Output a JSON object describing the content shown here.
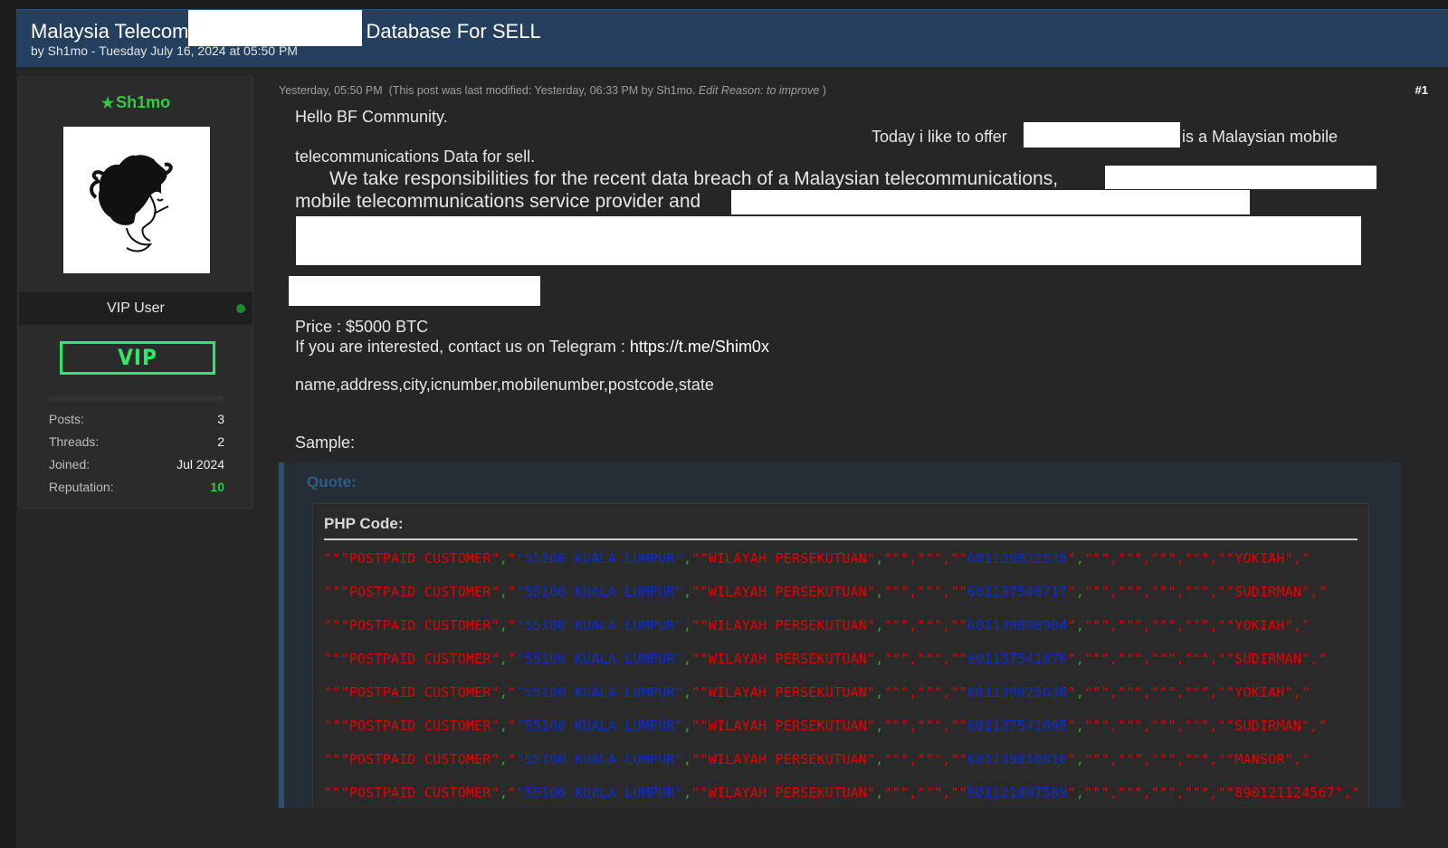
{
  "thread": {
    "title_prefix": "Malaysia Telecom",
    "title_suffix": "Database For SELL",
    "byline": "by Sh1mo - Tuesday July 16, 2024 at 05:50 PM"
  },
  "user": {
    "name": "Sh1mo",
    "role": "VIP User",
    "badge": "VIP",
    "stats": [
      {
        "label": "Posts:",
        "value": "3"
      },
      {
        "label": "Threads:",
        "value": "2"
      },
      {
        "label": "Joined:",
        "value": "Jul 2024"
      },
      {
        "label": "Reputation:",
        "value": "10"
      }
    ]
  },
  "post": {
    "meta_time": "Yesterday, 05:50 PM",
    "meta_modified": "(This post was last modified: Yesterday, 06:33 PM by Sh1mo.",
    "meta_reason": "Edit Reason: to improve",
    "meta_close": ")",
    "number": "#1",
    "greeting": "Hello BF Community.",
    "offer_pre": "Today i like to offer",
    "offer_post": "is a Malaysian mobile",
    "offer_cont": "telecommunications Data for sell.",
    "resp_line1": "We take responsibilities for the recent data breach of a Malaysian telecommunications,",
    "resp_line2": "mobile telecommunications service provider and",
    "price": "Price : $5000 BTC",
    "contact_pre": "If you are interested, contact us on Telegram :",
    "contact_link": "https://t.me/Shim0x",
    "fields": "name,address,city,icnumber,mobilenumber,postcode,state",
    "sample_label": "Sample:"
  },
  "quote": {
    "label": "Quote:",
    "code_label": "PHP Code:",
    "prefix": "\"\"\"POSTPAID CUSTOMER\"",
    "city": "\"55100 KUALA LUMPUR\"",
    "state": "\"\"WILAYAH PERSEKUTUAN\"",
    "empties": "\"\"\",\"\"\",\"\"",
    "tail_empties": "\"\"\",\"\"\",\"\"\",\"\"\",\"\"",
    "lines": [
      {
        "number": "601139022528",
        "name": "YOKIAH"
      },
      {
        "number": "601137540717",
        "name": "SUDIRMAN"
      },
      {
        "number": "601139008904",
        "name": "YOKIAH"
      },
      {
        "number": "601137541076",
        "name": "SUDIRMAN"
      },
      {
        "number": "601139025630",
        "name": "YOKIAH"
      },
      {
        "number": "601137541095",
        "name": "SUDIRMAN"
      },
      {
        "number": "601139010816",
        "name": "MANSOR"
      },
      {
        "number": "601121807589",
        "name": "890121124567"
      }
    ]
  },
  "colors": {
    "header_bg": "#24405e",
    "username": "#2ecc40",
    "vip_badge": "#2ee86a",
    "code_string": "#e60000",
    "code_value": "#0b2dd6",
    "code_comma": "#2ea82e"
  }
}
